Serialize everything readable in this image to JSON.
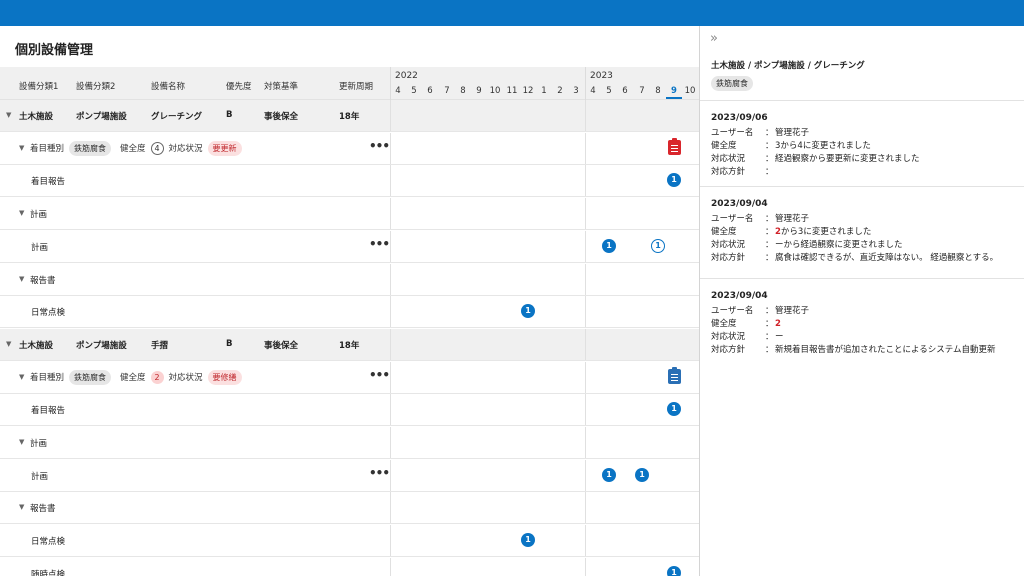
{
  "page": {
    "title": "個別設備管理"
  },
  "table": {
    "headers": [
      "設備分類1",
      "設備分類2",
      "設備名称",
      "優先度",
      "対策基準",
      "更新周期"
    ],
    "years": [
      "2022",
      "2023"
    ],
    "months": [
      "4",
      "5",
      "6",
      "7",
      "8",
      "9",
      "10",
      "11",
      "12",
      "1",
      "2",
      "3",
      "4",
      "5",
      "6",
      "7",
      "8",
      "9",
      "10"
    ],
    "current_month_index": 17,
    "groups": [
      {
        "cat1": "土木施設",
        "cat2": "ポンプ場施設",
        "name": "グレーチング",
        "priority": "B",
        "policy": "事後保全",
        "cycle": "18年",
        "focus_label": "着目種別",
        "focus_tag": "鉄筋腐食",
        "health_label": "健全度",
        "health_value": "4",
        "status_label": "対応状況",
        "status_value": "要更新",
        "report_label": "着目報告",
        "report_badge": "1",
        "plan_section": "計画",
        "plan_label": "計画",
        "plan_badges": [
          "1",
          "1"
        ],
        "docs_section": "報告書",
        "docs_label": "日常点検",
        "docs_badge": "1"
      },
      {
        "cat1": "土木施設",
        "cat2": "ポンプ場施設",
        "name": "手摺",
        "priority": "B",
        "policy": "事後保全",
        "cycle": "18年",
        "focus_label": "着目種別",
        "focus_tag": "鉄筋腐食",
        "health_label": "健全度",
        "health_value": "2",
        "status_label": "対応状況",
        "status_value": "要修繕",
        "report_label": "着目報告",
        "report_badge": "1",
        "plan_section": "計画",
        "plan_label": "計画",
        "plan_badges": [
          "1",
          "1"
        ],
        "docs_section": "報告書",
        "docs_label": "日常点検",
        "docs_badge": "1",
        "extra_label": "随時点検",
        "extra_badge": "1"
      }
    ]
  },
  "panel": {
    "breadcrumb": "土木施設 / ポンプ場施設 / グレーチング",
    "tag": "鉄筋腐食",
    "field_labels": {
      "user": "ユーザー名",
      "health": "健全度",
      "status": "対応状況",
      "policy": "対応方針",
      "sep": "："
    },
    "entries": [
      {
        "date": "2023/09/06",
        "user": "管理花子",
        "health_num": "",
        "health": "3から4に変更されました",
        "status": "経過観察から要更新に変更されました",
        "policy": ""
      },
      {
        "date": "2023/09/04",
        "user": "管理花子",
        "health_num": "2",
        "health": "から3に変更されました",
        "status": "ーから経過観察に変更されました",
        "policy": "腐食は確認できるが、直近支障はない。 経過観察とする。"
      },
      {
        "date": "2023/09/04",
        "user": "管理花子",
        "health_num": "2",
        "health": "",
        "status": "ー",
        "policy": "新規着目報告書が追加されたことによるシステム自動更新"
      }
    ]
  },
  "colors": {
    "accent": "#0a74c4",
    "alert": "#d9262c",
    "header_bg": "#f0f0f0"
  }
}
